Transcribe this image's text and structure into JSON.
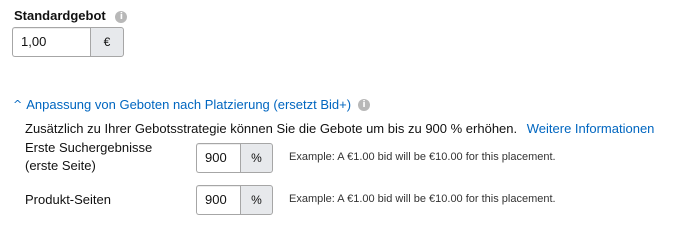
{
  "standard_bid": {
    "label": "Standardgebot",
    "info_icon": "info-icon",
    "value": "1,00",
    "currency": "€"
  },
  "placement": {
    "toggle_icon": "chevron-up-icon",
    "title": "Anpassung von Geboten nach Platzierung (ersetzt Bid+)",
    "info_icon": "info-icon",
    "description": "Zusätzlich zu Ihrer Gebotsstrategie können Sie die Gebote um bis zu 900 % erhöhen.",
    "more_link": "Weitere Informationen",
    "rows": [
      {
        "label_line1": "Erste Suchergebnisse",
        "label_line2": "(erste Seite)",
        "value": "900",
        "unit": "%",
        "example": "Example: A €1.00 bid will be €10.00 for this placement."
      },
      {
        "label_line1": "Produkt-Seiten",
        "label_line2": "",
        "value": "900",
        "unit": "%",
        "example": "Example: A €1.00 bid will be €10.00 for this placement."
      }
    ]
  },
  "colors": {
    "link": "#0066c0",
    "addon_bg": "#e7e9ec",
    "border": "#a6a6a6",
    "info_icon": "#b8b8b8"
  }
}
